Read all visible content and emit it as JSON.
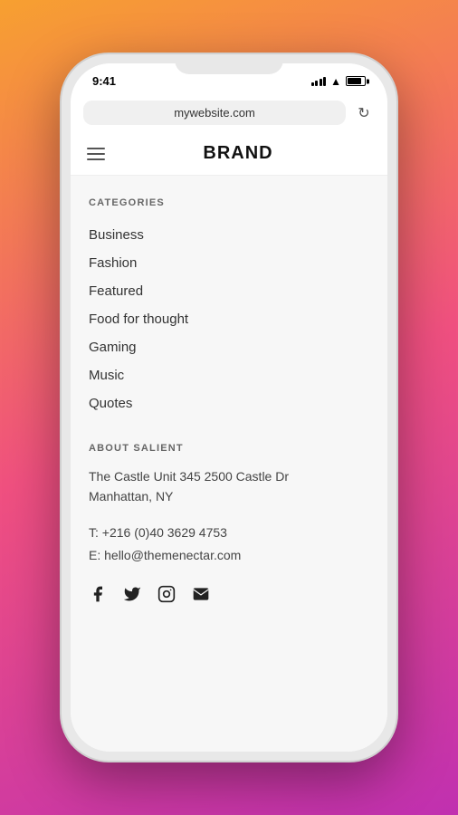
{
  "status": {
    "time": "9:41",
    "url": "mywebsite.com"
  },
  "nav": {
    "brand": "BRAND"
  },
  "categories_section": {
    "title": "CATEGORIES",
    "items": [
      {
        "label": "Business"
      },
      {
        "label": "Fashion"
      },
      {
        "label": "Featured"
      },
      {
        "label": "Food for thought"
      },
      {
        "label": "Gaming"
      },
      {
        "label": "Music"
      },
      {
        "label": "Quotes"
      }
    ]
  },
  "about_section": {
    "title": "ABOUT SALIENT",
    "address_line1": "The Castle Unit 345 2500 Castle Dr",
    "address_line2": "Manhattan, NY",
    "phone": "T: +216 (0)40 3629 4753",
    "email": "E: hello@themenectar.com"
  },
  "social": {
    "facebook": "f",
    "twitter": "🐦",
    "instagram": "📷",
    "mail": "✉"
  }
}
